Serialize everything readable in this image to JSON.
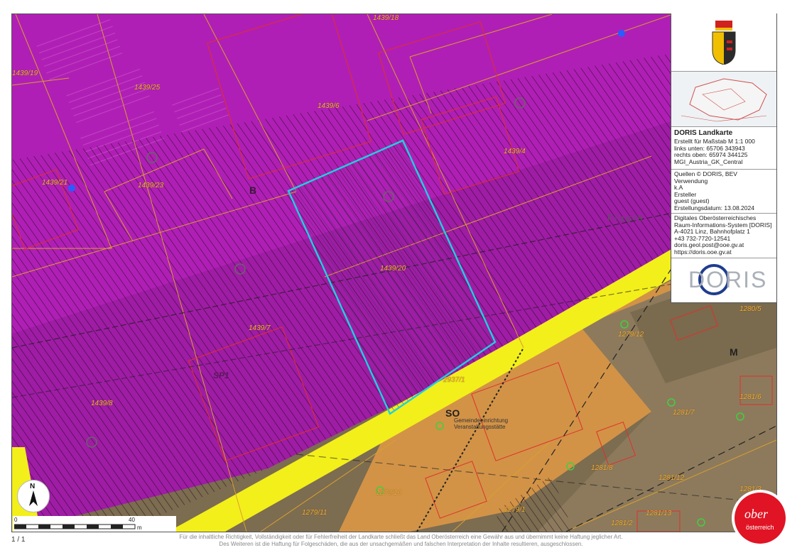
{
  "map": {
    "parcel_labels": [
      {
        "text": "1439/18"
      },
      {
        "text": "1439/19"
      },
      {
        "text": "1439/25"
      },
      {
        "text": "1439/6"
      },
      {
        "text": "1439/21"
      },
      {
        "text": "1439/23"
      },
      {
        "text": "1439/4"
      },
      {
        "text": "1439/20"
      },
      {
        "text": "1439/7"
      },
      {
        "text": "1439/8"
      },
      {
        "text": "2937/1"
      },
      {
        "text": "1279/12"
      },
      {
        "text": "1280/5"
      },
      {
        "text": "1281/6"
      },
      {
        "text": "1281/7"
      },
      {
        "text": "1281/8"
      },
      {
        "text": "1281/12"
      },
      {
        "text": "1281/13"
      },
      {
        "text": "1279/10"
      },
      {
        "text": "1279/11"
      },
      {
        "text": "1281/2"
      },
      {
        "text": "1281/3"
      },
      {
        "text": "1279/1"
      }
    ],
    "zone_labels": {
      "b": "B",
      "sp": "SP1",
      "so": "SO",
      "m1": "M",
      "m2": "M",
      "fl": "F l u g l ä"
    },
    "so_note": [
      "Gemeindeeinrichtung",
      "Veranstaltungsstätte"
    ],
    "colors": {
      "industrial": "#b01fb5",
      "commercial": "#e29a45",
      "road": "#f3ef1a",
      "selection": "#1ed0e0"
    }
  },
  "sidebar": {
    "title": "DORIS Landkarte",
    "scale_info": [
      "Erstellt für Maßstab M 1:1 000",
      "links unten: 65706 343943",
      "rechts oben: 65974 344125",
      "MGI_Austria_GK_Central"
    ],
    "sources": [
      "Quellen © DORIS, BEV",
      "Verwendung",
      "k.A",
      "Ersteller",
      "guest (guest)",
      "Erstellungsdatum: 13.08.2024"
    ],
    "contact": [
      "Digitales Oberösterreichisches",
      "Raum-Informations-System [DORIS]",
      "A-4021 Linz, Bahnhofplatz 1",
      "+43 732-7720-12541",
      "doris.geol.post@ooe.gv.at",
      "https://doris.ooe.gv.at"
    ],
    "logo_text": "DORIS"
  },
  "scalebar": {
    "start": "0",
    "mid": "40",
    "unit": "m"
  },
  "north": "N",
  "ober_logo": {
    "line1": "ober",
    "line2": "österreich"
  },
  "page_number": "1 / 1",
  "disclaimer": [
    "Für die inhaltliche Richtigkeit, Vollständigkeit oder für Fehlerfreiheit der Landkarte schließt das Land Oberösterreich eine Gewähr aus und übernimmt keine Haftung jeglicher Art.",
    "Des Weiteren ist die Haftung für Folgeschäden, die aus der unsachgemäßen und falschen Interpretation der Inhalte resultieren, ausgeschlossen."
  ]
}
